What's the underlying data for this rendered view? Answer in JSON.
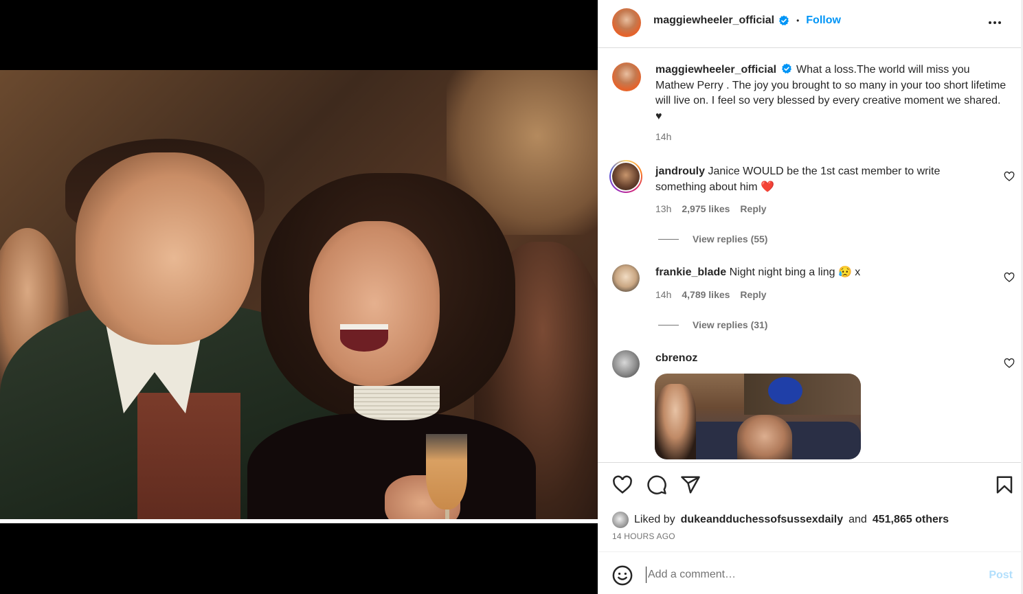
{
  "post": {
    "author": "maggiewheeler_official",
    "follow_label": "Follow",
    "separator": "•",
    "caption": "What a loss.The world will miss you Mathew Perry . The joy you brought to so many in your too short lifetime will live on. I feel so very blessed by every creative moment we shared. ♥",
    "caption_time": "14h"
  },
  "comments": [
    {
      "username": "jandrouly",
      "text": "Janice WOULD be the 1st cast member to write something about him ❤️",
      "time": "13h",
      "likes": "2,975 likes",
      "reply_label": "Reply",
      "view_replies": "View replies (55)"
    },
    {
      "username": "frankie_blade",
      "text": "Night night bing a ling 😥 x",
      "time": "14h",
      "likes": "4,789 likes",
      "reply_label": "Reply",
      "view_replies": "View replies (31)"
    },
    {
      "username": "cbrenoz"
    }
  ],
  "likes": {
    "prefix": "Liked by",
    "liker": "dukeandduchessofsussexdaily",
    "connector": "and",
    "others": "451,865 others"
  },
  "time_ago": "14 HOURS AGO",
  "add_comment": {
    "placeholder": "Add a comment…",
    "post_label": "Post"
  },
  "icons": {
    "verified": "verified-badge-icon",
    "more": "more-options-icon",
    "like": "heart-icon",
    "comment": "comment-icon",
    "share": "share-icon",
    "save": "bookmark-icon",
    "emoji": "emoji-icon"
  },
  "colors": {
    "accent": "#0095f6",
    "post_disabled": "#b2dffc",
    "muted": "#737373"
  }
}
